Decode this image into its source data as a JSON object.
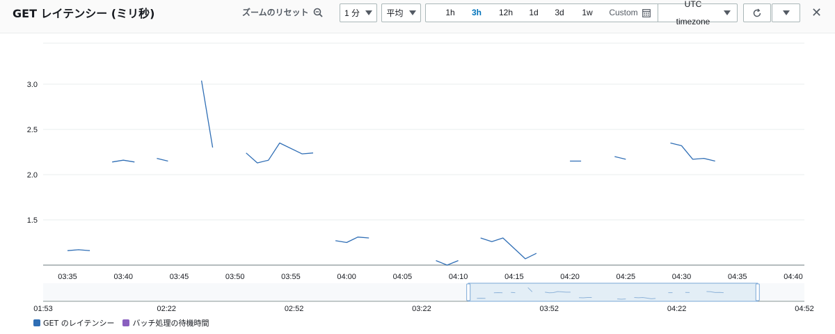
{
  "header": {
    "title": "GET レイテンシー (ミリ秒)",
    "zoom_reset": "ズームのリセット",
    "period": "1 分",
    "statistic": "平均",
    "ranges": [
      "1h",
      "3h",
      "12h",
      "1d",
      "3d",
      "1w"
    ],
    "active_range": "3h",
    "custom": "Custom",
    "timezone": "UTC timezone"
  },
  "colors": {
    "accent": "#0073bb",
    "series1": "#2f6eb5",
    "series2": "#8a5fbf"
  },
  "legend": [
    {
      "label": "GET のレイテンシー",
      "color": "#2f6eb5"
    },
    {
      "label": "バッチ処理の待機時間",
      "color": "#8a5fbf"
    }
  ],
  "chart_data": {
    "type": "line",
    "title": "GET レイテンシー (ミリ秒)",
    "xlabel": "",
    "ylabel": "",
    "x_ticks": [
      "03:35",
      "03:40",
      "03:45",
      "03:50",
      "03:55",
      "04:00",
      "04:05",
      "04:10",
      "04:15",
      "04:20",
      "04:25",
      "04:30",
      "04:35",
      "04:40"
    ],
    "y_ticks": [
      1.5,
      2.0,
      2.5,
      3.0
    ],
    "ylim": [
      1.0,
      3.2
    ],
    "grid": true,
    "series": [
      {
        "name": "GET のレイテンシー",
        "segments": [
          [
            [
              "03:35",
              1.16
            ],
            [
              "03:36",
              1.17
            ],
            [
              "03:37",
              1.16
            ]
          ],
          [
            [
              "03:39",
              2.14
            ],
            [
              "03:40",
              2.16
            ],
            [
              "03:41",
              2.14
            ]
          ],
          [
            [
              "03:43",
              2.18
            ],
            [
              "03:44",
              2.15
            ]
          ],
          [
            [
              "03:47",
              3.04
            ],
            [
              "03:48",
              2.3
            ]
          ],
          [
            [
              "03:51",
              2.24
            ],
            [
              "03:52",
              2.13
            ],
            [
              "03:53",
              2.16
            ],
            [
              "03:54",
              2.35
            ],
            [
              "03:56",
              2.23
            ],
            [
              "03:57",
              2.24
            ]
          ],
          [
            [
              "03:59",
              1.27
            ],
            [
              "04:00",
              1.25
            ],
            [
              "04:01",
              1.31
            ],
            [
              "04:02",
              1.3
            ]
          ],
          [
            [
              "04:08",
              1.05
            ],
            [
              "04:09",
              1.0
            ],
            [
              "04:10",
              1.05
            ]
          ],
          [
            [
              "04:12",
              1.3
            ],
            [
              "04:13",
              1.26
            ],
            [
              "04:14",
              1.3
            ],
            [
              "04:16",
              1.07
            ],
            [
              "04:17",
              1.13
            ]
          ],
          [
            [
              "04:20",
              2.15
            ],
            [
              "04:21",
              2.15
            ]
          ],
          [
            [
              "04:24",
              2.2
            ],
            [
              "04:25",
              2.17
            ]
          ],
          [
            [
              "04:29",
              2.35
            ],
            [
              "04:30",
              2.32
            ],
            [
              "04:31",
              2.17
            ],
            [
              "04:32",
              2.18
            ],
            [
              "04:33",
              2.15
            ]
          ]
        ]
      },
      {
        "name": "バッチ処理の待機時間",
        "segments": []
      }
    ],
    "overview": {
      "x_ticks": [
        "01:53",
        "02:22",
        "02:52",
        "03:22",
        "03:52",
        "04:22",
        "04:52"
      ],
      "brush_range": [
        "03:33",
        "04:41"
      ]
    }
  }
}
